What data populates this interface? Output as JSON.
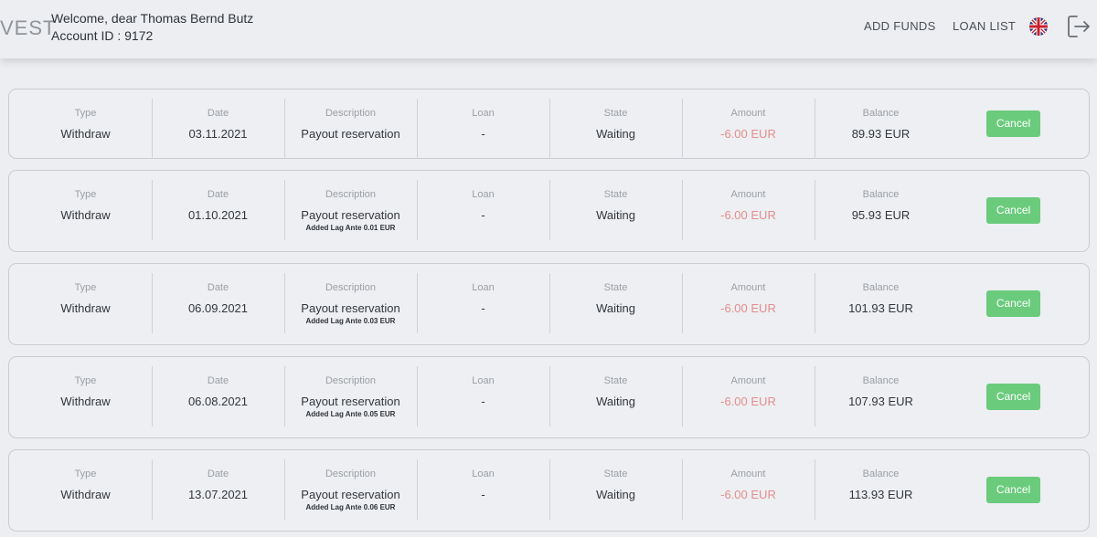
{
  "header": {
    "logo_text": "VEST",
    "welcome": "Welcome, dear Thomas Bernd Butz",
    "account_id": "Account ID : 9172",
    "nav": {
      "add_funds": "ADD FUNDS",
      "loan_list": "LOAN LIST"
    },
    "language_icon": "uk-flag-icon",
    "logout_icon": "logout-icon"
  },
  "columns": {
    "type": "Type",
    "date": "Date",
    "description": "Description",
    "loan": "Loan",
    "state": "State",
    "amount": "Amount",
    "balance": "Balance"
  },
  "colors": {
    "negative_amount": "#e48d8d",
    "cancel_button": "#6acb7c"
  },
  "transactions": [
    {
      "type": "Withdraw",
      "date": "03.11.2021",
      "description": "Payout reservation",
      "note": "",
      "loan": "-",
      "state": "Waiting",
      "amount": "-6.00 EUR",
      "balance": "89.93 EUR",
      "action": "Cancel"
    },
    {
      "type": "Withdraw",
      "date": "01.10.2021",
      "description": "Payout reservation",
      "note": "Added Lag Ante 0.01 EUR",
      "loan": "-",
      "state": "Waiting",
      "amount": "-6.00 EUR",
      "balance": "95.93 EUR",
      "action": "Cancel"
    },
    {
      "type": "Withdraw",
      "date": "06.09.2021",
      "description": "Payout reservation",
      "note": "Added Lag Ante 0.03 EUR",
      "loan": "-",
      "state": "Waiting",
      "amount": "-6.00 EUR",
      "balance": "101.93 EUR",
      "action": "Cancel"
    },
    {
      "type": "Withdraw",
      "date": "06.08.2021",
      "description": "Payout reservation",
      "note": "Added Lag Ante 0.05 EUR",
      "loan": "-",
      "state": "Waiting",
      "amount": "-6.00 EUR",
      "balance": "107.93 EUR",
      "action": "Cancel"
    },
    {
      "type": "Withdraw",
      "date": "13.07.2021",
      "description": "Payout reservation",
      "note": "Added Lag Ante 0.06 EUR",
      "loan": "-",
      "state": "Waiting",
      "amount": "-6.00 EUR",
      "balance": "113.93 EUR",
      "action": "Cancel"
    }
  ]
}
